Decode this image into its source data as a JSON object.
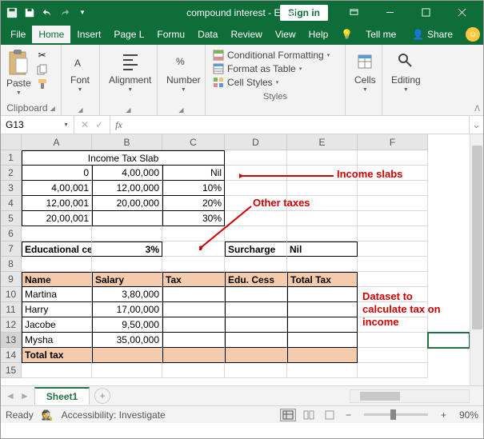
{
  "titlebar": {
    "title": "compound interest - Excel",
    "signin": "Sign in"
  },
  "menu": {
    "file": "File",
    "home": "Home",
    "insert": "Insert",
    "pagel": "Page L",
    "formu": "Formu",
    "data": "Data",
    "review": "Review",
    "view": "View",
    "help": "Help",
    "tellme": "Tell me",
    "share": "Share"
  },
  "ribbon": {
    "clipboard": {
      "paste": "Paste",
      "label": "Clipboard"
    },
    "font": {
      "btn": "Font",
      "label": ""
    },
    "alignment": {
      "btn": "Alignment",
      "label": ""
    },
    "number": {
      "btn": "Number",
      "label": ""
    },
    "styles": {
      "cond": "Conditional Formatting",
      "table": "Format as Table",
      "cell": "Cell Styles",
      "label": "Styles"
    },
    "cells": {
      "btn": "Cells",
      "label": ""
    },
    "editing": {
      "btn": "Editing",
      "label": ""
    }
  },
  "namebox": "G13",
  "cols": {
    "A": 88,
    "B": 88,
    "C": 78,
    "D": 78,
    "E": 88,
    "F": 88
  },
  "sheet": {
    "r1": {
      "title": "Income Tax Slab"
    },
    "r2": {
      "a": "0",
      "b": "4,00,000",
      "c": "Nil"
    },
    "r3": {
      "a": "4,00,001",
      "b": "12,00,000",
      "c": "10%"
    },
    "r4": {
      "a": "12,00,001",
      "b": "20,00,000",
      "c": "20%"
    },
    "r5": {
      "a": "20,00,001",
      "b": "",
      "c": "30%"
    },
    "r7": {
      "a": "Educational cess",
      "b": "3%",
      "d": "Surcharge",
      "e": "Nil"
    },
    "r9": {
      "a": "Name",
      "b": "Salary",
      "c": "Tax",
      "d": "Edu. Cess",
      "e": "Total Tax"
    },
    "r10": {
      "a": "Martina",
      "b": "3,80,000"
    },
    "r11": {
      "a": "Harry",
      "b": "17,00,000"
    },
    "r12": {
      "a": "Jacobe",
      "b": "9,50,000"
    },
    "r13": {
      "a": "Mysha",
      "b": "35,00,000"
    },
    "r14": {
      "a": "Total tax"
    }
  },
  "annot": {
    "slabs": "Income slabs",
    "other": "Other taxes",
    "dataset": "Dataset to calculate tax on income"
  },
  "tabs": {
    "sheet1": "Sheet1"
  },
  "status": {
    "ready": "Ready",
    "access": "Accessibility: Investigate",
    "zoom": "90%"
  }
}
